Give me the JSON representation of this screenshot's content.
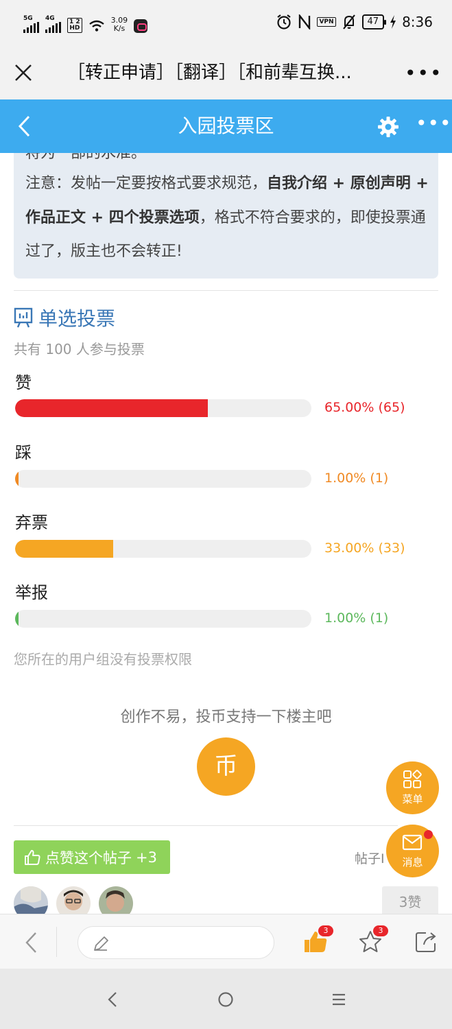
{
  "status_bar": {
    "signal1": "5G",
    "signal2": "4G",
    "hd_top": "1 2",
    "hd_bottom": "HD",
    "speed_value": "3.09",
    "speed_unit": "K/s",
    "vpn": "VPN",
    "battery": "47",
    "time": "8:36"
  },
  "browser": {
    "title": "［转正申请］［翻译］［和前辈互换..."
  },
  "forum": {
    "title": "入园投票区"
  },
  "notice": {
    "cut_line": "将为一部的水准。",
    "line_prefix": "注意：发帖一定要按格式要求规范，",
    "bold": "自我介绍 + 原创声明 + 作品正文 + 四个投票选项",
    "line_suffix": "，格式不符合要求的，即使投票通过了，版主也不会转正!"
  },
  "poll": {
    "title": "单选投票",
    "participants": "共有 100 人参与投票",
    "options": [
      {
        "label": "赞",
        "percent_text": "65.00% (65)",
        "fraction": 0.65,
        "color": "#e8262b"
      },
      {
        "label": "踩",
        "percent_text": "1.00% (1)",
        "fraction": 0.01,
        "color": "#f08a24"
      },
      {
        "label": "弃票",
        "percent_text": "33.00% (33)",
        "fraction": 0.33,
        "color": "#f5a623"
      },
      {
        "label": "举报",
        "percent_text": "1.00% (1)",
        "fraction": 0.01,
        "color": "#5cb85c"
      }
    ],
    "no_permission": "您所在的用户组没有投票权限"
  },
  "support": {
    "text": "创作不易，投币支持一下楼主吧",
    "coin_label": "币"
  },
  "fab": {
    "menu_label": "菜单",
    "message_label": "消息"
  },
  "like": {
    "button_label": "点赞这个帖子",
    "plus": "+3",
    "post_id_text": "帖子I",
    "likes_count": "3赞"
  },
  "bottom_bar": {
    "thumb_badge": "3",
    "star_badge": "3"
  },
  "colors": {
    "header_blue": "#3dabef",
    "accent_orange": "#f5a623",
    "like_green": "#8fd35a",
    "poll_title_blue": "#3a77b6"
  },
  "icons": [
    "close-icon",
    "more-icon",
    "back-icon",
    "gear-icon",
    "poll-icon",
    "menu-grid-icon",
    "mail-icon",
    "thumbs-up-icon",
    "pencil-icon",
    "star-icon",
    "share-icon",
    "nav-back-icon",
    "nav-home-icon",
    "nav-menu-icon"
  ]
}
